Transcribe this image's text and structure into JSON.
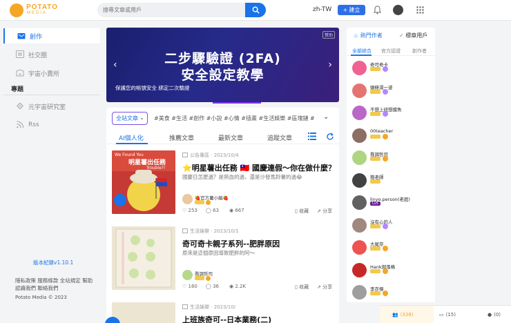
{
  "header": {
    "logo_text": "POTATO",
    "logo_sub": "MEDIA",
    "search_placeholder": "搜尋文章或用戶",
    "language": "zh-TW",
    "create_label": "建立"
  },
  "sidebar": {
    "items": [
      {
        "label": "創作",
        "icon": "create-icon",
        "active": true
      },
      {
        "label": "社交圈",
        "icon": "social-icon",
        "active": false
      },
      {
        "label": "宇宙小賣所",
        "icon": "shop-icon",
        "active": false
      }
    ],
    "section_title": "專題",
    "topics": [
      {
        "label": "元宇宙研究室",
        "icon": "gear-icon"
      },
      {
        "label": "Rss",
        "icon": "rss-icon"
      }
    ],
    "version": "版本紀錄v1.10.1",
    "links": [
      "隱私政策",
      "服務條款",
      "全站規定",
      "幫助",
      "認識我們",
      "聯絡我們"
    ],
    "copyright": "Potato Media © 2023"
  },
  "banner": {
    "title_line1": "二步驟驗證 (2FA)",
    "title_line2": "安全設定教學",
    "subtitle": "保護您的帳號安全 綁定二次驗證",
    "ad_label": "贊助"
  },
  "filters": {
    "all_label": "全站文章",
    "tags": [
      "#美食",
      "#生活",
      "#創作",
      "#小說",
      "#心情",
      "#插畫",
      "#生活娛樂",
      "#區塊鏈",
      "#"
    ]
  },
  "tabs": [
    {
      "label": "AI個人化",
      "active": true
    },
    {
      "label": "推薦文章",
      "active": false
    },
    {
      "label": "最新文章",
      "active": false
    },
    {
      "label": "追蹤文章",
      "active": false
    }
  ],
  "posts": [
    {
      "category": "公告專區",
      "date": "2023/10/4",
      "title": "⭐明星薯出任務 🇹🇼 國慶連假～你在做什麼？",
      "desc": "國慶日怎麼過？是熱血的過，還是沙發馬鈴薯的過😂",
      "author": "🍓官方薯小編🍓",
      "likes": "253",
      "comments": "63",
      "views": "667",
      "save_label": "收藏",
      "share_label": "分享",
      "thumb_caption1": "We Found You",
      "thumb_caption2": "明星薯出任務",
      "thumb_caption3": "Trouble?!"
    },
    {
      "category": "生活娛樂",
      "date": "2023/10/1",
      "title": "奇可奇卡親子系列--肥胖原因",
      "desc": "原來是這個原因導致肥胖的阿～",
      "author": "喬調哲司",
      "likes": "160",
      "comments": "36",
      "views": "2.2K",
      "save_label": "收藏",
      "share_label": "分享"
    },
    {
      "category": "生活娛樂",
      "date": "2023/10/",
      "title": "上班族奇可--日本業務(二)"
    }
  ],
  "right_panel": {
    "tab_hot": "熱門作者",
    "tab_recommend": "標章用戶",
    "subtabs": [
      "全部綜合",
      "官方認證",
      "創作者"
    ],
    "users": [
      {
        "name": "奇可奇卡",
        "avatar_color": "#f06292",
        "badge_color": "#b388ff"
      },
      {
        "name": "頭條湯一波",
        "avatar_color": "#e57373",
        "badge_color": "#b388ff"
      },
      {
        "name": "不想上班想摸魚",
        "avatar_color": "#ba68c8",
        "badge_color": "#b388ff"
      },
      {
        "name": "00teacher",
        "avatar_color": "#8d6e63",
        "badge_color": "#f5a623"
      },
      {
        "name": "喬調哲司",
        "avatar_color": "#aed581",
        "badge_color": "#f5a623"
      },
      {
        "name": "簡老師",
        "avatar_color": "#424242",
        "badge_color": ""
      },
      {
        "name": "linyo.person(老屁)",
        "avatar_color": "#616161",
        "badge_color": "",
        "level_text": "Lv5"
      },
      {
        "name": "沒有心的人",
        "avatar_color": "#a1887f",
        "badge_color": "#b388ff"
      },
      {
        "name": "大尾奈",
        "avatar_color": "#ef5350",
        "badge_color": "#f5a623"
      },
      {
        "name": "Hank部落格",
        "avatar_color": "#c62828",
        "badge_color": "#f5a623"
      },
      {
        "name": "李亦傑",
        "avatar_color": "#9e9e9e",
        "badge_color": "#f5a623"
      }
    ]
  },
  "bottom_bar": {
    "online": "(338)",
    "messages": "(15)",
    "friends": "(0)"
  },
  "colors": {
    "accent": "#1a73e8",
    "brand": "#f5a623"
  }
}
